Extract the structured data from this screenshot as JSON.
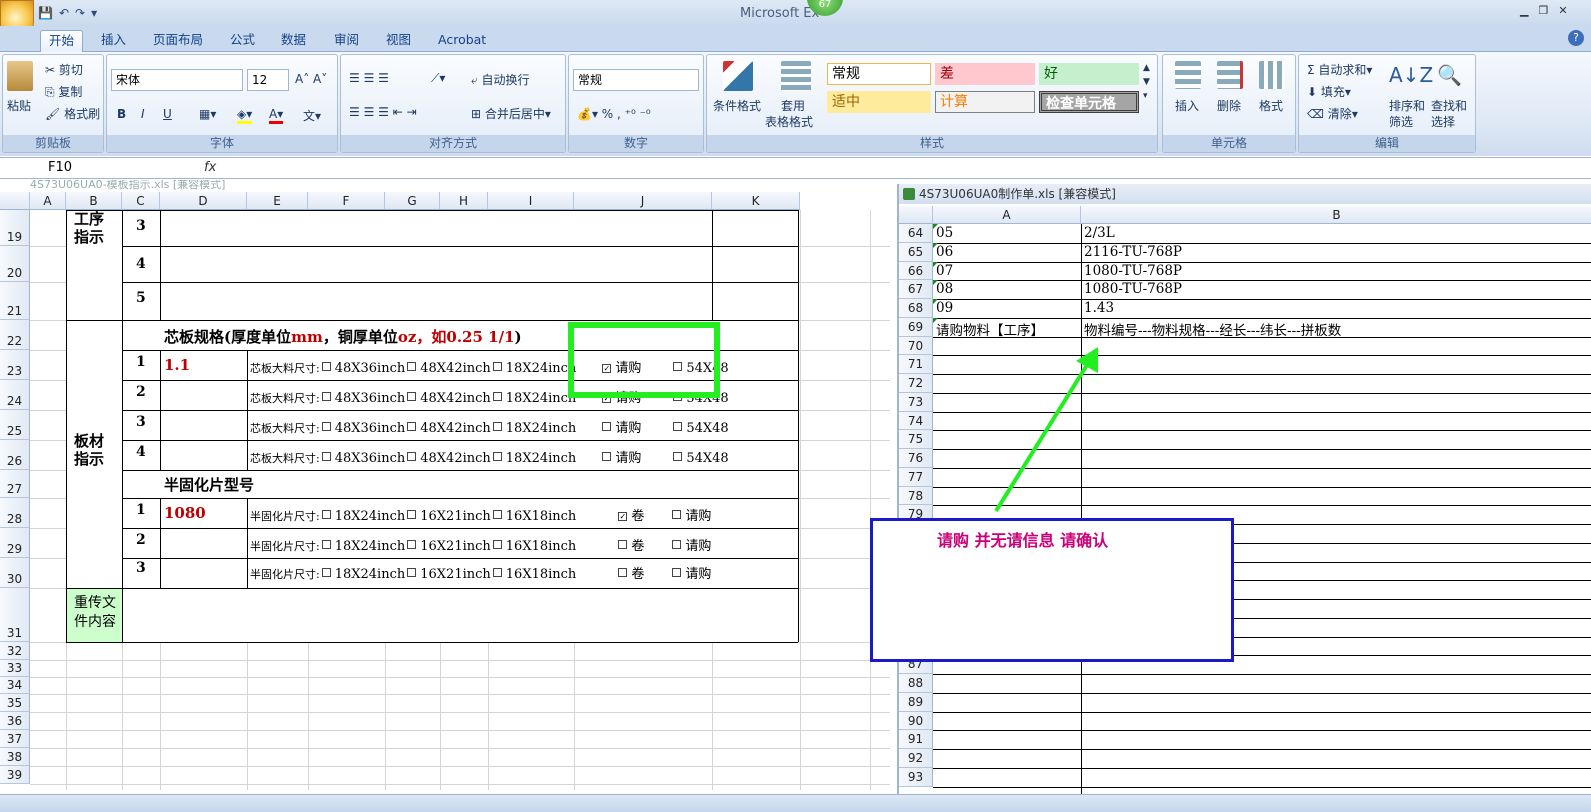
{
  "app": {
    "title": "Microsoft Ex",
    "badge": "67"
  },
  "tabs": [
    "开始",
    "插入",
    "页面布局",
    "公式",
    "数据",
    "审阅",
    "视图",
    "Acrobat"
  ],
  "ribbon": {
    "clipboard": {
      "paste": "粘贴",
      "cut": "剪切",
      "copy": "复制",
      "format_painter": "格式刷",
      "label": "剪贴板"
    },
    "font": {
      "name": "宋体",
      "size": "12",
      "label": "字体"
    },
    "align": {
      "wrap": "自动换行",
      "merge": "合并后居中",
      "label": "对齐方式"
    },
    "number": {
      "format": "常规",
      "label": "数字"
    },
    "styles": {
      "cond": "条件格式",
      "table": "套用",
      "table2": "表格格式",
      "label": "样式",
      "normal": "常规",
      "bad": "差",
      "good": "好",
      "neutral": "适中",
      "calc": "计算",
      "check": "检查单元格"
    },
    "cells": {
      "insert": "插入",
      "delete": "删除",
      "format": "格式",
      "label": "单元格"
    },
    "edit": {
      "autosum": "自动求和",
      "fill": "填充",
      "clear": "清除",
      "sort": "排序和",
      "sort2": "筛选",
      "find": "查找和",
      "find2": "选择",
      "label": "编辑"
    }
  },
  "formula_bar": {
    "cell": "F10",
    "fx": "fx"
  },
  "left_sheet": {
    "title": "4S73U06UA0-模板指示.xls [兼容模式]",
    "cols": [
      "A",
      "B",
      "C",
      "D",
      "E",
      "F",
      "G",
      "H",
      "I",
      "J",
      "K"
    ],
    "rows": [
      "19",
      "20",
      "21",
      "22",
      "23",
      "24",
      "25",
      "26",
      "27",
      "28",
      "29",
      "30",
      "31",
      "32",
      "33",
      "34",
      "35",
      "36",
      "37",
      "38",
      "39"
    ],
    "section1": "工序指示",
    "section2": "板材指示",
    "section3": "重传文件内容",
    "nums": [
      "3",
      "4",
      "5",
      "1",
      "2",
      "3",
      "4",
      "1",
      "2",
      "3"
    ],
    "core_header": "芯板规格(厚度单位",
    "core_mm": "mm",
    "core_mid": "，铜厚单位",
    "core_oz": "oz，如0.25 1/1",
    ")": ")",
    "core_val": "1.1",
    "pp_header": "半固化片型号",
    "pp_val": "1080",
    "core_label": "芯板大料尺寸:",
    "pp_label": "半固化片尺寸:",
    "core_opts": [
      "48X36inch",
      "48X42inch",
      "18X24inch",
      "请购",
      "54X48"
    ],
    "pp_opts": [
      "18X24inch",
      "16X21inch",
      "16X18inch",
      "卷",
      "请购"
    ]
  },
  "right_sheet": {
    "title": "4S73U06UA0制作单.xls  [兼容模式]",
    "cols": [
      "A",
      "B"
    ],
    "rows": [
      "64",
      "65",
      "66",
      "67",
      "68",
      "69",
      "70",
      "71",
      "72",
      "73",
      "74",
      "75",
      "76",
      "77",
      "78",
      "79",
      "80",
      "81",
      "82",
      "83",
      "84",
      "85",
      "86",
      "87",
      "88",
      "89",
      "90",
      "91",
      "92",
      "93"
    ],
    "colA": [
      "05",
      "06",
      "07",
      "08",
      "09",
      "请购物料【工序】"
    ],
    "colB": [
      "2/3L",
      "2116-TU-768P",
      "1080-TU-768P",
      "1080-TU-768P",
      "1.43",
      "物料编号---物料规格---经长---纬长---拼板数"
    ]
  },
  "annotation": {
    "text": "请购 并无请信息 请确认",
    "color": "#cc0077"
  },
  "colors": {
    "highlight": "#22ee22",
    "box": "#1a1acc"
  }
}
